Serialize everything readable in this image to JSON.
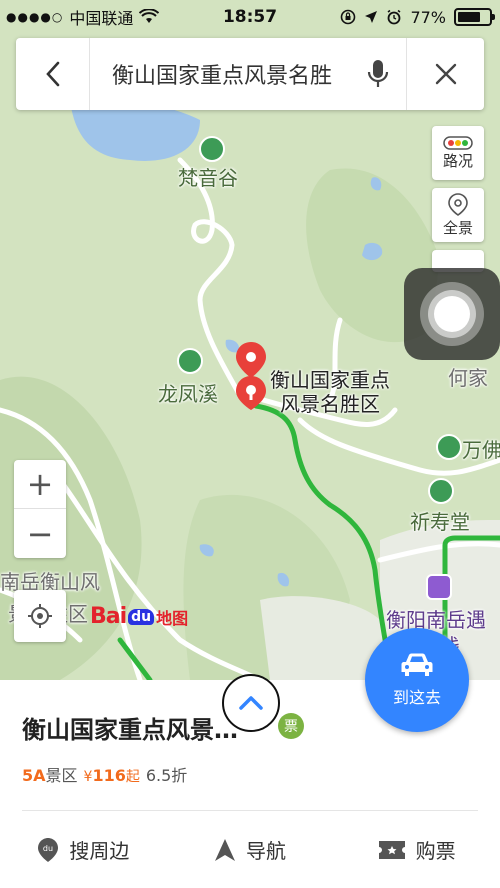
{
  "status_bar": {
    "carrier": "中国联通",
    "time": "18:57",
    "battery": "77%",
    "battery_level": 0.77
  },
  "search": {
    "query": "衡山国家重点风景名胜"
  },
  "map_controls": {
    "traffic_label": "路况",
    "panorama_label": "全景",
    "zoom_in": "+",
    "zoom_out": "−"
  },
  "map_labels": {
    "fanyingu": "梵音谷",
    "longfengxi": "龙凤溪",
    "marker_line1": "衡山国家重点",
    "marker_line2": "风景名胜区",
    "hejia": "何家",
    "wanfo": "万佛",
    "shoutang": "祈寿堂",
    "nanyue1": "南岳衡山风",
    "nanyue2": "景名胜区",
    "hotel1": "衡阳南岳遇",
    "hotel2": "客栈"
  },
  "logo": {
    "bai": "Bai",
    "du": "du",
    "ditu": "地图"
  },
  "go_button": {
    "label": "到这去"
  },
  "place": {
    "title": "衡山国家重点风景…",
    "ticket_badge": "票",
    "grade": "5A",
    "grade_suffix": "景区",
    "price_symbol": "¥",
    "price": "116",
    "price_suffix": "起",
    "discount": "6.5折"
  },
  "actions": [
    {
      "label": "搜周边"
    },
    {
      "label": "导航"
    },
    {
      "label": "购票"
    }
  ],
  "colors": {
    "accent_blue": "#3385ff",
    "marker_red": "#e8403a",
    "route_green": "#2fb63c",
    "badge_green": "#7cb342",
    "price_orange": "#f26b1d"
  }
}
